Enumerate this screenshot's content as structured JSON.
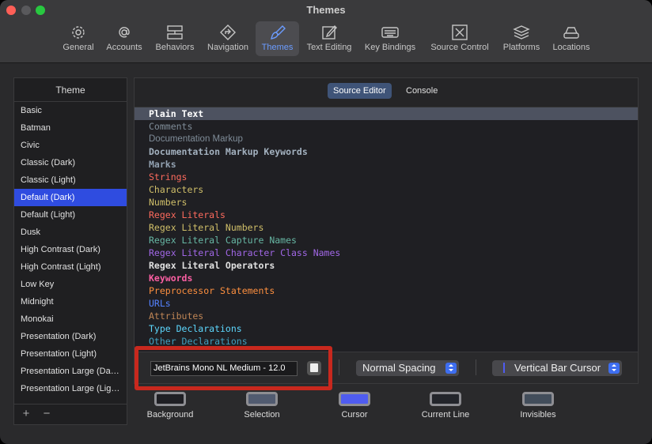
{
  "window": {
    "title": "Themes"
  },
  "toolbar": {
    "tabs": [
      {
        "label": "General",
        "icon": "gear-icon"
      },
      {
        "label": "Accounts",
        "icon": "at-icon"
      },
      {
        "label": "Behaviors",
        "icon": "behaviors-icon"
      },
      {
        "label": "Navigation",
        "icon": "navigation-icon"
      },
      {
        "label": "Themes",
        "icon": "paintbrush-icon"
      },
      {
        "label": "Text Editing",
        "icon": "pencil-icon"
      },
      {
        "label": "Key Bindings",
        "icon": "keyboard-icon"
      },
      {
        "label": "Source Control",
        "icon": "source-control-icon"
      },
      {
        "label": "Platforms",
        "icon": "layers-icon"
      },
      {
        "label": "Locations",
        "icon": "drive-icon"
      }
    ],
    "active_tab": "Themes"
  },
  "sidebar": {
    "header": "Theme",
    "items": [
      "Basic",
      "Batman",
      "Civic",
      "Classic (Dark)",
      "Classic (Light)",
      "Default (Dark)",
      "Default (Light)",
      "Dusk",
      "High Contrast (Dark)",
      "High Contrast (Light)",
      "Low Key",
      "Midnight",
      "Monokai",
      "Presentation (Dark)",
      "Presentation (Light)",
      "Presentation Large (Da…",
      "Presentation Large (Lig…"
    ],
    "selected": "Default (Dark)",
    "add_label": "+",
    "remove_label": "−"
  },
  "segments": {
    "source_editor": "Source Editor",
    "console": "Console"
  },
  "editor": {
    "lines": [
      {
        "text": "Plain Text",
        "color": "#ffffff",
        "bold": true
      },
      {
        "text": "Comments",
        "color": "#7f8c98",
        "bold": false
      },
      {
        "text": "Documentation Markup",
        "color": "#7f8c98",
        "bold": false,
        "sans": true
      },
      {
        "text": "Documentation Markup Keywords",
        "color": "#a3b1bf",
        "bold": true
      },
      {
        "text": "Marks",
        "color": "#92a1b1",
        "bold": true
      },
      {
        "text": "Strings",
        "color": "#fc6a5d",
        "bold": false
      },
      {
        "text": "Characters",
        "color": "#d0bf69",
        "bold": false
      },
      {
        "text": "Numbers",
        "color": "#d0bf69",
        "bold": false
      },
      {
        "text": "Regex Literals",
        "color": "#fc6a5d",
        "bold": false
      },
      {
        "text": "Regex Literal Numbers",
        "color": "#d0bf69",
        "bold": false
      },
      {
        "text": "Regex Literal Capture Names",
        "color": "#67b7a4",
        "bold": false
      },
      {
        "text": "Regex Literal Character Class Names",
        "color": "#a167e6",
        "bold": false
      },
      {
        "text": "Regex Literal Operators",
        "color": "#e0e0e0",
        "bold": true
      },
      {
        "text": "Keywords",
        "color": "#fc5fa3",
        "bold": true
      },
      {
        "text": "Preprocessor Statements",
        "color": "#fd8f3f",
        "bold": false
      },
      {
        "text": "URLs",
        "color": "#5482ff",
        "bold": false
      },
      {
        "text": "Attributes",
        "color": "#bf8555",
        "bold": false
      },
      {
        "text": "Type Declarations",
        "color": "#5dd8ff",
        "bold": false
      },
      {
        "text": "Other Declarations",
        "color": "#41a1c0",
        "bold": false
      }
    ]
  },
  "bottom": {
    "font_value": "JetBrains Mono NL Medium - 12.0",
    "spacing_value": "Normal Spacing",
    "cursor_value": "Vertical Bar Cursor"
  },
  "swatches": [
    {
      "label": "Background",
      "color": "#1f1f24"
    },
    {
      "label": "Selection",
      "color": "#515b70"
    },
    {
      "label": "Cursor",
      "color": "#4f5cf0"
    },
    {
      "label": "Current Line",
      "color": "#23252b"
    },
    {
      "label": "Invisibles",
      "color": "#424d5b"
    }
  ]
}
